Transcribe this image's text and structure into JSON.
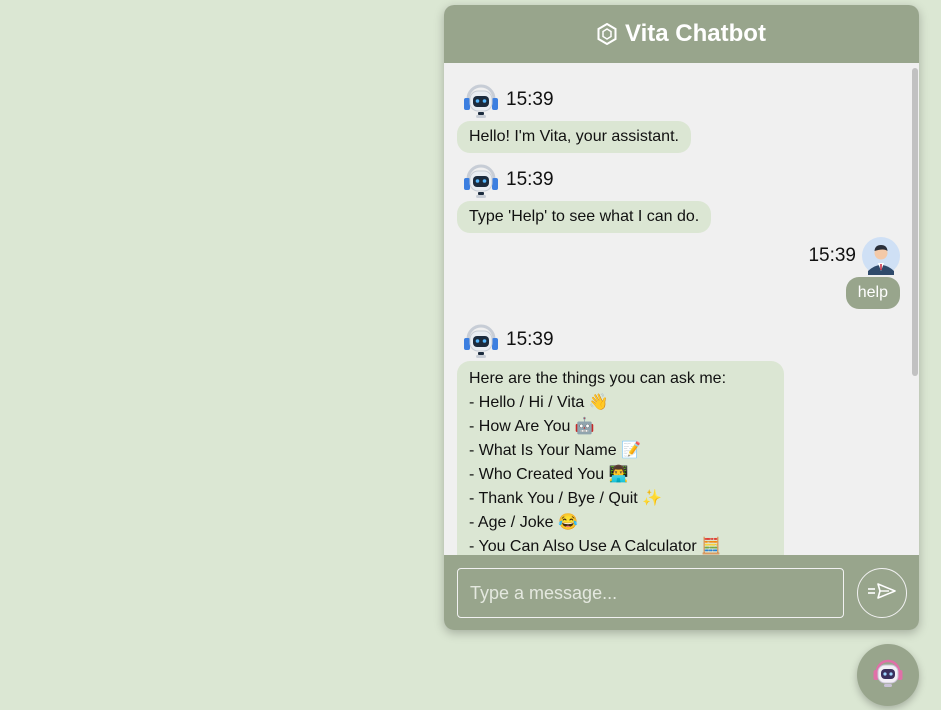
{
  "header": {
    "title": "Vita Chatbot",
    "icon": "hexagon-icon"
  },
  "messages": [
    {
      "sender": "bot",
      "time": "15:39",
      "text": "Hello! I'm Vita, your assistant."
    },
    {
      "sender": "bot",
      "time": "15:39",
      "text": "Type 'Help' to see what I can do."
    },
    {
      "sender": "user",
      "time": "15:39",
      "text": "help"
    },
    {
      "sender": "bot",
      "time": "15:39",
      "lines": [
        "Here are the things you can ask me:",
        "- Hello / Hi / Vita 👋",
        "- How Are You 🤖",
        "- What Is Your Name 📝",
        "- Who Created You 👨‍💻",
        "- Thank You / Bye / Quit ✨",
        "- Age / Joke 😂",
        "- You Can Also Use A Calculator 🧮"
      ]
    }
  ],
  "input": {
    "placeholder": "Type a message...",
    "value": ""
  },
  "send_button": {
    "icon": "send-icon"
  },
  "launcher": {
    "icon": "robot-icon"
  },
  "colors": {
    "page_background": "#dbe7d3",
    "header": "#98a58c",
    "bot_bubble": "#dbe6d3",
    "user_bubble": "#98a58c",
    "chat_background": "#f0f0f0"
  }
}
